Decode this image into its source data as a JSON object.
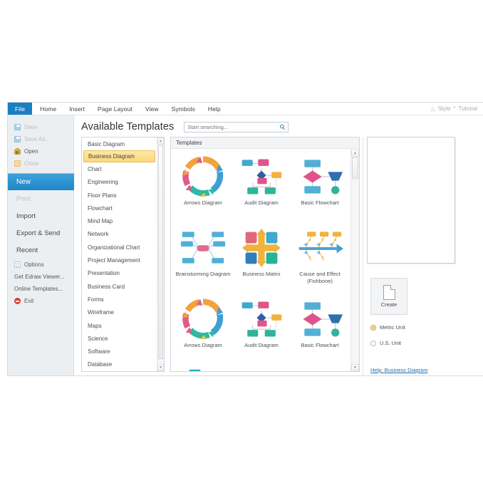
{
  "window": {
    "ribbon_tabs": [
      {
        "label": "File",
        "active": true
      },
      {
        "label": "Home",
        "active": false
      },
      {
        "label": "Insert",
        "active": false
      },
      {
        "label": "Page Layout",
        "active": false
      },
      {
        "label": "View",
        "active": false
      },
      {
        "label": "Symbols",
        "active": false
      },
      {
        "label": "Help",
        "active": false
      }
    ],
    "ribbon_right": [
      {
        "icon": "home-icon",
        "label": "Style"
      },
      {
        "icon": "star-icon",
        "label": "Tutorial"
      }
    ],
    "accent_color": "#1a7fc1",
    "highlight_color": "#fbd978"
  },
  "backstage": {
    "items": [
      {
        "label": "Save",
        "icon": "save-icon",
        "state": "disabled",
        "size": "small"
      },
      {
        "label": "Save As...",
        "icon": "save-as-icon",
        "state": "disabled",
        "size": "small"
      },
      {
        "label": "Open",
        "icon": "open-folder-icon",
        "state": "normal",
        "size": "small"
      },
      {
        "label": "Close",
        "icon": "close-folder-icon",
        "state": "disabled",
        "size": "small"
      },
      {
        "label": "New",
        "icon": "",
        "state": "active",
        "size": "big"
      },
      {
        "label": "Print",
        "icon": "",
        "state": "disabled",
        "size": "big"
      },
      {
        "label": "Import",
        "icon": "",
        "state": "normal",
        "size": "big"
      },
      {
        "label": "Export & Send",
        "icon": "",
        "state": "normal",
        "size": "big"
      },
      {
        "label": "Recent",
        "icon": "",
        "state": "normal",
        "size": "big"
      },
      {
        "label": "Options",
        "icon": "options-icon",
        "state": "normal",
        "size": "small"
      },
      {
        "label": "Get Edraw Viewer...",
        "icon": "",
        "state": "normal",
        "size": "small"
      },
      {
        "label": "Online Templates...",
        "icon": "",
        "state": "normal",
        "size": "small"
      },
      {
        "label": "Exit",
        "icon": "exit-icon",
        "state": "normal",
        "size": "small"
      }
    ]
  },
  "main": {
    "page_title": "Available Templates",
    "search": {
      "placeholder": "Start searching...",
      "value": "",
      "icon": "search-icon"
    },
    "categories": {
      "selected": "Business Diagram",
      "items": [
        "Basic Diagram",
        "Business Diagram",
        "Chart",
        "Engineering",
        "Floor Plans",
        "Flowchart",
        "Mind Map",
        "Network",
        "Organizational Chart",
        "Project Management",
        "Presentation",
        "Business Card",
        "Forms",
        "Wireframe",
        "Maps",
        "Science",
        "Software",
        "Database"
      ]
    },
    "templates": {
      "header": "Templates",
      "items": [
        {
          "label": "Arrows Diagram",
          "thumb": "arrows-circle"
        },
        {
          "label": "Audit Diagram",
          "thumb": "audit-flow"
        },
        {
          "label": "Basic Flowchart",
          "thumb": "basic-flow"
        },
        {
          "label": "Brainstorming Diagram",
          "thumb": "brainstorm"
        },
        {
          "label": "Business Matrix",
          "thumb": "matrix"
        },
        {
          "label": "Cause and Effect (Fishbone)",
          "thumb": "fishbone"
        },
        {
          "label": "Arrows Diagram",
          "thumb": "arrows-circle"
        },
        {
          "label": "Audit Diagram",
          "thumb": "audit-flow"
        },
        {
          "label": "Basic Flowchart",
          "thumb": "basic-flow"
        }
      ]
    }
  },
  "right_panel": {
    "create_label": "Create",
    "create_icon": "new-page-icon",
    "units": [
      {
        "label": "Metric Unit",
        "selected": true
      },
      {
        "label": "U.S. Unit",
        "selected": false
      }
    ],
    "help_link": "Help: Business Diagram"
  }
}
